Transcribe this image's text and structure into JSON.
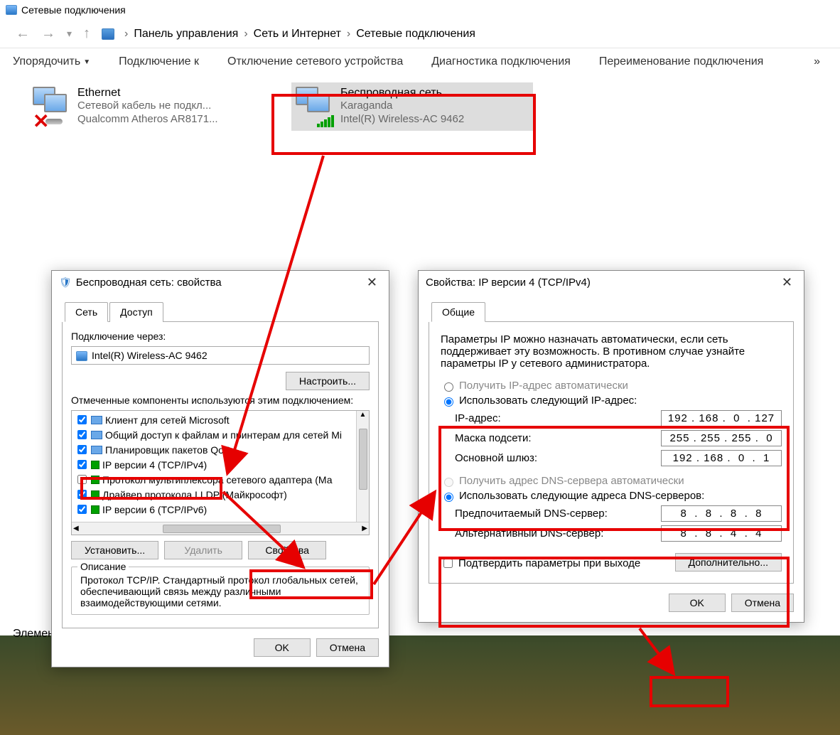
{
  "window": {
    "title": "Сетевые подключения"
  },
  "breadcrumb": {
    "items": [
      "Панель управления",
      "Сеть и Интернет",
      "Сетевые подключения"
    ]
  },
  "toolbar": {
    "organize": "Упорядочить",
    "connect_to": "Подключение к",
    "disable_device": "Отключение сетевого устройства",
    "diagnostics": "Диагностика подключения",
    "rename": "Переименование подключения",
    "more": "»"
  },
  "connections": {
    "ethernet": {
      "title": "Ethernet",
      "sub1": "Сетевой кабель не подкл...",
      "sub2": "Qualcomm Atheros AR8171..."
    },
    "wifi": {
      "title": "Беспроводная сеть",
      "sub1": "Karaganda",
      "sub2": "Intel(R) Wireless-AC 9462"
    }
  },
  "elem_text": "Элемен",
  "props_dialog": {
    "title": "Беспроводная сеть: свойства",
    "tab_network": "Сеть",
    "tab_access": "Доступ",
    "connect_through": "Подключение через:",
    "adapter": "Intel(R) Wireless-AC 9462",
    "configure": "Настроить...",
    "components_label": "Отмеченные компоненты используются этим подключением:",
    "components": [
      "Клиент для сетей Microsoft",
      "Общий доступ к файлам и принтерам для сетей Mi",
      "Планировщик пакетов QoS",
      "IP версии 4 (TCP/IPv4)",
      "Протокол мультиплексора сетевого адаптера (Ма",
      "Драйвер протокола LLDP (Майкрософт)",
      "IP версии 6 (TCP/IPv6)"
    ],
    "install": "Установить...",
    "remove": "Удалить",
    "properties": "Свойства",
    "description_title": "Описание",
    "description_text": "Протокол TCP/IP. Стандартный протокол глобальных сетей, обеспечивающий связь между различными взаимодействующими сетями.",
    "ok": "OK",
    "cancel": "Отмена"
  },
  "ipv4_dialog": {
    "title": "Свойства: IP версии 4 (TCP/IPv4)",
    "tab_general": "Общие",
    "intro": "Параметры IP можно назначать автоматически, если сеть поддерживает эту возможность. В противном случае узнайте параметры IP у сетевого администратора.",
    "radio_auto_ip": "Получить IP-адрес автоматически",
    "radio_use_ip": "Использовать следующий IP-адрес:",
    "ip_label": "IP-адрес:",
    "mask_label": "Маска подсети:",
    "gateway_label": "Основной шлюз:",
    "ip_value": "192 . 168 .  0  . 127",
    "mask_value": "255 . 255 . 255 .  0",
    "gateway_value": "192 . 168 .  0  .  1",
    "radio_auto_dns": "Получить адрес DNS-сервера автоматически",
    "radio_use_dns": "Использовать следующие адреса DNS-серверов:",
    "dns1_label": "Предпочитаемый DNS-сервер:",
    "dns2_label": "Альтернативный DNS-сервер:",
    "dns1_value": "8  .  8  .  8  .  8",
    "dns2_value": "8  .  8  .  4  .  4",
    "confirm_exit": "Подтвердить параметры при выходе",
    "advanced": "Дополнительно...",
    "ok": "OK",
    "cancel": "Отмена"
  }
}
